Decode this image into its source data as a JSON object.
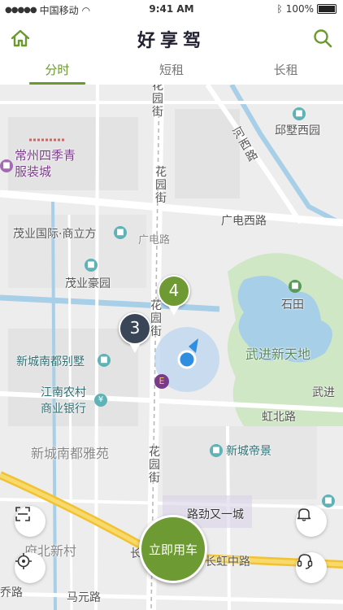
{
  "status_bar": {
    "carrier": "中国移动",
    "time": "9:41 AM",
    "battery": "100%"
  },
  "header": {
    "title": "好享驾",
    "home_icon": "home-icon",
    "search_icon": "search-icon"
  },
  "tabs": [
    {
      "label": "分时",
      "active": true
    },
    {
      "label": "短租",
      "active": false
    },
    {
      "label": "长租",
      "active": false
    }
  ],
  "map": {
    "labels": {
      "qiushu_xiyuan": "邱墅西园",
      "changzhou_siji": "常州四季青",
      "fuzhuang_cheng": "服装城",
      "guangdian_xilu": "广电西路",
      "maoye_guoji": "茂业国际·商立方",
      "guangdian_lu": "广电路",
      "maoye_haoyuan": "茂业豪园",
      "shitian": "石田",
      "wujin_xintiandi": "武进新天地",
      "xincheng_nandu_bieshu": "新城南都别墅",
      "jiangnan_nongcun": "江南农村",
      "shangye_yinhang": "商业银行",
      "wujin_short": "武进",
      "hongbei_lu": "虹北路",
      "xincheng_nandu_yayuan": "新城南都雅苑",
      "xincheng_dijing": "新城帝景",
      "lujin_youyicheng": "路劲又一城",
      "fubei_xincun": "府北新村",
      "changhong_zhonglu": "长虹中路",
      "chang_fragment": "长",
      "maoyuan_lu": "马元路",
      "xiaqiao_lu": "乔路",
      "huayuan_jie": "花园街",
      "hexi_lu": "河西路"
    },
    "vehicle_pins": [
      {
        "count": "4",
        "color": "#6e9a34"
      },
      {
        "count": "3",
        "color": "#3a4558"
      }
    ],
    "colors": {
      "land": "#ededed",
      "road": "#ffffff",
      "water": "#a8cfe8",
      "park": "#cfe7c4",
      "highway": "#f1c232",
      "accent": "#6a9a2b"
    }
  },
  "controls": {
    "scan_icon": "scan-icon",
    "locate_icon": "locate-icon",
    "bell_icon": "bell-icon",
    "headset_icon": "headset-icon",
    "rent_button": "立即用车"
  }
}
